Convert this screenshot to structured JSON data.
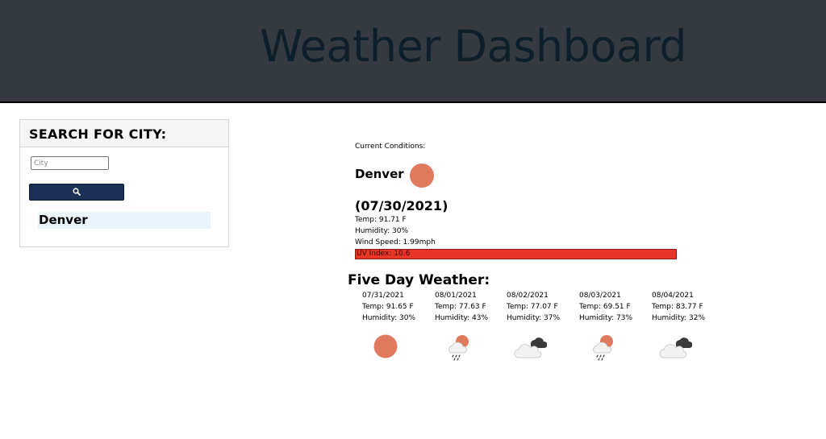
{
  "header": {
    "title": "Weather Dashboard"
  },
  "search": {
    "title": "SEARCH FOR CITY:",
    "placeholder": "City",
    "button_icon": "search-icon",
    "history": [
      "Denver"
    ]
  },
  "current": {
    "label": "Current Conditions:",
    "city": "Denver",
    "icon": "sun-icon",
    "date": "(07/30/2021)",
    "temp": "Temp: 91.71 F",
    "humidity": "Humidity: 30%",
    "wind": "Wind Speed: 1.99mph",
    "uv": "UV Index: 10.6"
  },
  "forecast": {
    "title": "Five Day Weather:",
    "days": [
      {
        "date": "07/31/2021",
        "temp": "Temp: 91.65 F",
        "humidity": "Humidity: 30%",
        "icon": "sun-icon"
      },
      {
        "date": "08/01/2021",
        "temp": "Temp: 77.63 F",
        "humidity": "Humidity: 43%",
        "icon": "rain-sun-icon"
      },
      {
        "date": "08/02/2021",
        "temp": "Temp: 77.07 F",
        "humidity": "Humidity: 37%",
        "icon": "cloudy-icon"
      },
      {
        "date": "08/03/2021",
        "temp": "Temp: 69.51 F",
        "humidity": "Humidity: 73%",
        "icon": "rain-sun-icon"
      },
      {
        "date": "08/04/2021",
        "temp": "Temp: 83.77 F",
        "humidity": "Humidity: 32%",
        "icon": "cloudy-icon"
      }
    ]
  },
  "colors": {
    "header_bg": "#343a40",
    "button_bg": "#1a3055",
    "sun": "#e07a5f",
    "uv_high": "#e93528",
    "history_bg": "#eaf4fb"
  }
}
